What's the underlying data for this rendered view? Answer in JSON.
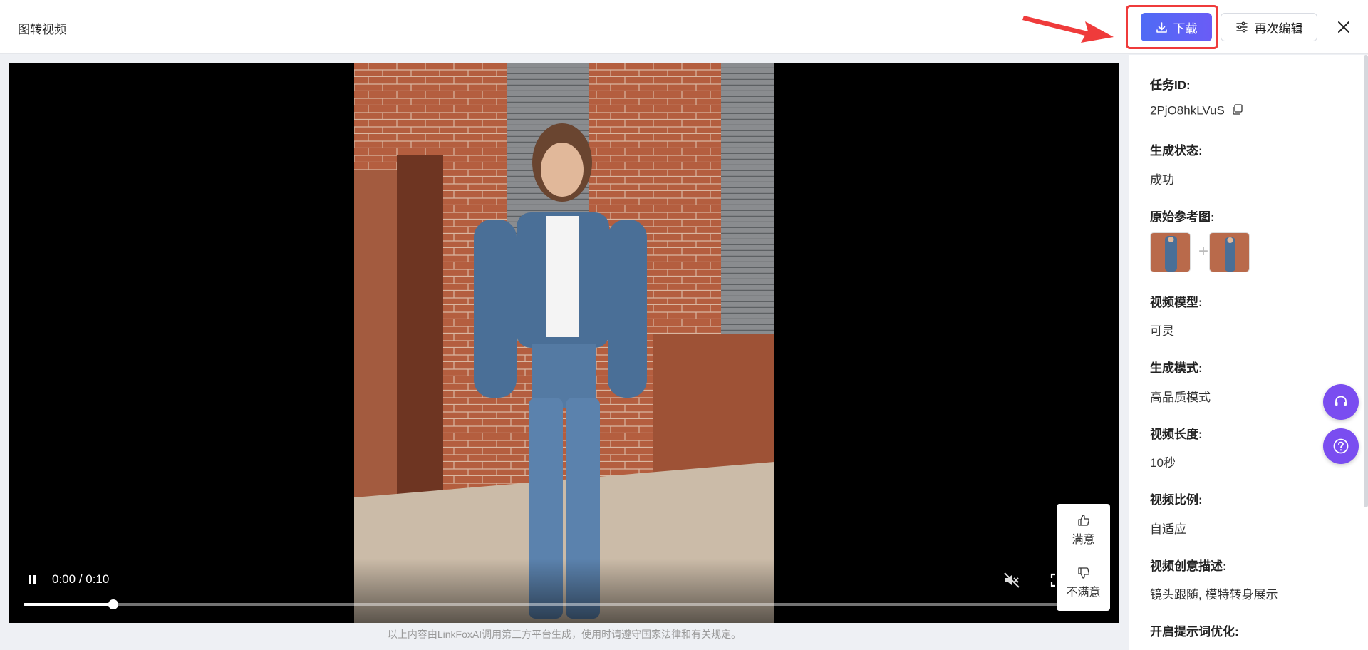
{
  "header": {
    "title": "图转视频",
    "download_label": "下载",
    "re_edit_label": "再次编辑"
  },
  "colors": {
    "accent_gradient_start": "#4f6bf5",
    "accent_gradient_end": "#6a5cf6",
    "highlight_red": "#ef3b3b",
    "float_button": "#7a4df0"
  },
  "icons": {
    "download": "download-icon",
    "re_edit": "sliders-icon",
    "close": "close-icon",
    "copy": "copy-icon",
    "play_state": "pause-icon",
    "volume": "volume-muted-icon",
    "fullscreen": "fullscreen-icon",
    "more": "more-vertical-icon",
    "thumbs_up": "thumbs-up-icon",
    "thumbs_down": "thumbs-down-icon",
    "support": "headset-icon",
    "help": "question-icon"
  },
  "player": {
    "time": "0:00 / 0:10",
    "progress": 0.083
  },
  "feedback": {
    "satisfied": "满意",
    "unsatisfied": "不满意"
  },
  "disclaimer": "以上内容由LinkFoxAI调用第三方平台生成，使用时请遵守国家法律和有关规定。",
  "details": {
    "task_id_label": "任务ID:",
    "task_id_value": "2PjO8hkLVuS",
    "status_label": "生成状态:",
    "status_value": "成功",
    "ref_label": "原始参考图:",
    "model_label": "视频模型:",
    "model_value": "可灵",
    "mode_label": "生成模式:",
    "mode_value": "高品质模式",
    "length_label": "视频长度:",
    "length_value": "10秒",
    "ratio_label": "视频比例:",
    "ratio_value": "自适应",
    "desc_label": "视频创意描述:",
    "desc_value": "镜头跟随, 模特转身展示",
    "optimize_label": "开启提示词优化:"
  }
}
